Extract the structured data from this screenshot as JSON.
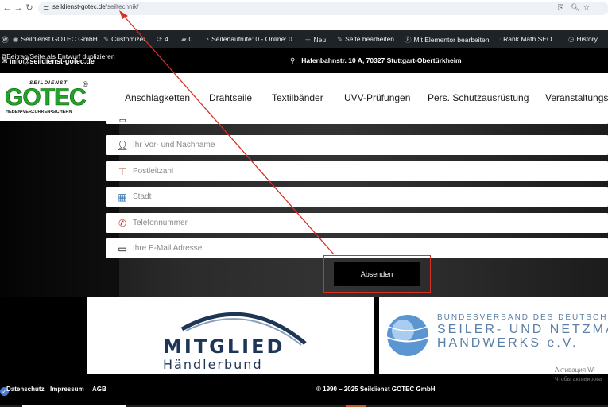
{
  "browser": {
    "url_domain": "seildienst-gotec.de",
    "url_path": "/seiltechnik/",
    "back_icon": "arrow-left-icon",
    "forward_icon": "arrow-right-icon",
    "reload_icon": "reload-icon"
  },
  "adminbar": {
    "site_name": "Seildienst GOTEC GmbH",
    "customizer": "Customizer",
    "updates_count": "4",
    "comments_count": "0",
    "page_views": "Seitenaufrufe: 0 - Online: 0",
    "new": "Neu",
    "edit_page": "Seite bearbeiten",
    "elementor": "Mit Elementor bearbeiten",
    "rankmath": "Rank Math SEO",
    "history": "History"
  },
  "infobar": {
    "duplicate_link": "Beitrag/Seite als Entwurf duplizieren",
    "email": "info@seildienst-gotec.de",
    "address": "Hafenbahnstr. 10 A, 70327 Stuttgart-Obertürkheim"
  },
  "logo": {
    "top": "SEILDIENST",
    "brand": "GOTEC",
    "tagline": "HEBEN•VERZURREN•SICHERN",
    "registered": "®"
  },
  "nav": {
    "items": [
      "Anschlagketten",
      "Drahtseile",
      "Textilbänder",
      "UVV-Prüfungen",
      "Pers. Schutzausrüstung",
      "Veranstaltungst"
    ]
  },
  "form": {
    "name_placeholder": "Ihr Vor- und Nachname",
    "zip_placeholder": "Postleitzahl",
    "city_placeholder": "Stadt",
    "phone_placeholder": "Telefonnummer",
    "email_placeholder": "Ihre E-Mail Adresse",
    "submit_label": "Absenden"
  },
  "logos": {
    "mitglied": "MITGLIED",
    "haendlerbund": "Händlerbund",
    "bund_line1": "BUNDESVERBAND DES DEUTSCHEN",
    "bund_line2": "SEILER- UND NETZMA",
    "bund_line3": "HANDWERKS e.V."
  },
  "watermark": {
    "line1": "Активация Wi",
    "line2": "Чтобы активирова"
  },
  "footer": {
    "datenschutz": "Datenschutz",
    "impressum": "Impressum",
    "agb": "AGB",
    "copyright": "® 1990 – 2025 Seildienst GOTEC GmbH"
  },
  "colors": {
    "brand_green": "#22a527",
    "admin_bar": "#1d2327",
    "highlight_red": "#d93025"
  }
}
